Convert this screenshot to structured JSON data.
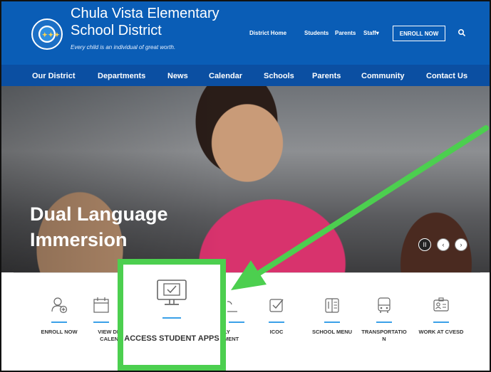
{
  "header": {
    "brand_line1": "Chula Vista Elementary",
    "brand_line2": "School District",
    "tagline": "Every child is an individual of great worth.",
    "utility": [
      "District Home",
      "Students",
      "Parents",
      "Staff▾"
    ],
    "enroll_label": "ENROLL NOW"
  },
  "nav": {
    "items": [
      "Our District",
      "Departments",
      "News",
      "Calendar",
      "Schools",
      "Parents",
      "Community",
      "Contact Us"
    ]
  },
  "hero": {
    "title": "Dual Language Immersion",
    "pause": "II",
    "prev": "‹",
    "next": "›"
  },
  "quicklinks": {
    "items": [
      {
        "label": "ENROLL NOW",
        "icon": "add-user-icon"
      },
      {
        "label": "VIEW DI\nCALEN",
        "icon": "calendar-icon"
      },
      {
        "label": "LY\nMENT",
        "icon": "person-icon"
      },
      {
        "label": "ICOC",
        "icon": "checkbox-icon"
      },
      {
        "label": "SCHOOL MENU",
        "icon": "menu-book-icon"
      },
      {
        "label": "TRANSPORTATIO\nN",
        "icon": "bus-icon"
      },
      {
        "label": "WORK AT CVESD",
        "icon": "id-card-icon"
      }
    ],
    "highlight": {
      "label": "ACCESS STUDENT APPS",
      "icon": "monitor-check-icon"
    }
  },
  "colors": {
    "header_blue": "#0a5db6",
    "nav_blue": "#0b4fa2",
    "highlight_green": "#4ccf4f",
    "accent_bar": "#3aa0e8"
  }
}
